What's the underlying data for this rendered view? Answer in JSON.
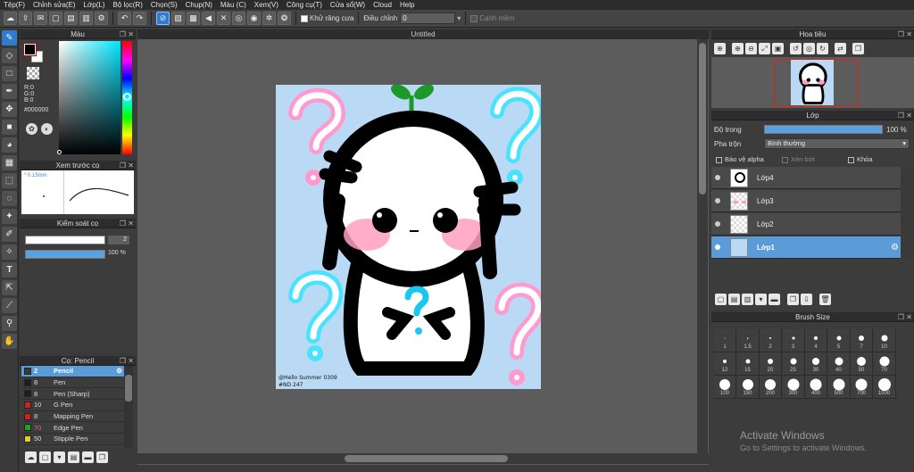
{
  "menu": [
    "Tệp(F)",
    "Chỉnh sửa(E)",
    "Lớp(L)",
    "Bộ lọc(R)",
    "Chọn(S)",
    "Chụp(N)",
    "Màu (C)",
    "Xem(V)",
    "Công cụ(T)",
    "Cửa sổ(W)",
    "Cloud",
    "Help"
  ],
  "toolbar": {
    "antialias_label": "Khử răng cưa",
    "adjust_label": "Điều chỉnh",
    "adjust_value": "0",
    "snap_label": "Cạnh mềm"
  },
  "color_panel": {
    "title": "Màu",
    "r": "R:0",
    "g": "G:0",
    "b": "B:0",
    "hex": "#000000",
    "fg_color": "#000000",
    "bg_color": "#ffffff"
  },
  "preview_panel": {
    "title": "Xem trước cọ",
    "size_text": "* 0.15mm"
  },
  "brush_control": {
    "title": "Kiểm soát cọ",
    "size": "2",
    "opacity": "100 %"
  },
  "brush_list": {
    "title": "Cọ: Pencil",
    "items": [
      {
        "num": "2",
        "name": "Pencil",
        "color": "#3a3a3a",
        "selected": true
      },
      {
        "num": "8",
        "name": "Pen",
        "color": "#1e1e1e",
        "selected": false
      },
      {
        "num": "8",
        "name": "Pen (Sharp)",
        "color": "#1e1e1e",
        "selected": false
      },
      {
        "num": "10",
        "name": "G Pen",
        "color": "#d22020",
        "selected": false
      },
      {
        "num": "8",
        "name": "Mapping Pen",
        "color": "#d22020",
        "selected": false
      },
      {
        "num": "70",
        "name": "Edge Pen",
        "color": "#20a020",
        "selected": false
      },
      {
        "num": "50",
        "name": "Stipple Pen",
        "color": "#e0d020",
        "selected": false
      }
    ]
  },
  "canvas": {
    "tab_title": "Untitled",
    "signature": "@Hello Summer 0309",
    "tag": "#ND 247"
  },
  "navigator": {
    "title": "Hoa tiêu"
  },
  "layers": {
    "title": "Lớp",
    "opacity_label": "Độ trong",
    "opacity_value": "100 %",
    "blend_label": "Pha trộn",
    "blend_value": "Bình thường",
    "protect_alpha": "Bảo vệ alpha",
    "clipping": "Xén bớt",
    "lock": "Khóa",
    "items": [
      {
        "name": "Lớp4",
        "selected": false
      },
      {
        "name": "Lớp3",
        "selected": false
      },
      {
        "name": "Lớp2",
        "selected": false
      },
      {
        "name": "Lớp1",
        "selected": true
      }
    ]
  },
  "brush_size": {
    "title": "Brush Size",
    "sizes": [
      "1",
      "1.5",
      "2",
      "3",
      "4",
      "5",
      "7",
      "10",
      "12",
      "15",
      "20",
      "25",
      "30",
      "40",
      "50",
      "70",
      "100",
      "150",
      "200",
      "300",
      "400",
      "500",
      "700",
      "1000"
    ]
  },
  "watermark": {
    "line1": "Activate Windows",
    "line2": "Go to Settings to activate Windows."
  },
  "colors": {
    "accent": "#2e7bcf",
    "selection": "#5a9bd8",
    "canvas_bg": "#b9d9f4"
  }
}
